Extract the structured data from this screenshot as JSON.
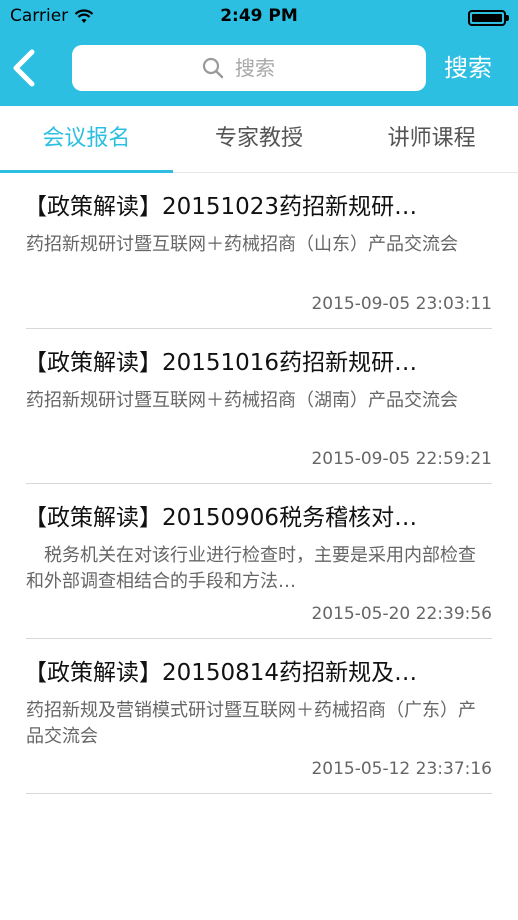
{
  "status_bar": {
    "carrier": "Carrier",
    "time": "2:49 PM"
  },
  "nav": {
    "search_placeholder": "搜索",
    "search_button": "搜索"
  },
  "tabs": [
    {
      "label": "会议报名",
      "active": true
    },
    {
      "label": "专家教授",
      "active": false
    },
    {
      "label": "讲师课程",
      "active": false
    }
  ],
  "items": [
    {
      "title": "【政策解读】20151023药招新规研…",
      "desc": "药招新规研讨暨互联网＋药械招商（山东）产品交流会",
      "date": "2015-09-05 23:03:11"
    },
    {
      "title": "【政策解读】20151016药招新规研…",
      "desc": "药招新规研讨暨互联网＋药械招商（湖南）产品交流会",
      "date": "2015-09-05 22:59:21"
    },
    {
      "title": "【政策解读】20150906税务稽核对…",
      "desc": "　税务机关在对该行业进行检查时，主要是采用内部检查和外部调查相结合的手段和方法…",
      "date": "2015-05-20 22:39:56"
    },
    {
      "title": "【政策解读】20150814药招新规及…",
      "desc": "药招新规及营销模式研讨暨互联网＋药械招商（广东）产品交流会",
      "date": "2015-05-12 23:37:16"
    }
  ],
  "colors": {
    "accent": "#2cbfe2"
  }
}
